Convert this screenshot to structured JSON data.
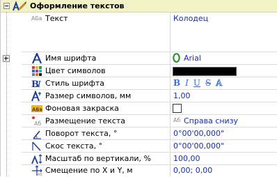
{
  "header": {
    "title": "Оформление текстов"
  },
  "rows": {
    "text": {
      "label": "Текст",
      "value": "Колодец",
      "icon": "abv-text-icon"
    },
    "font_name": {
      "label": "Имя шрифта",
      "value": "Arial",
      "icon": "font-a-icon"
    },
    "color": {
      "label": "Цвет символов",
      "value_color": "#000000",
      "icon": "color-grid-icon"
    },
    "font_style": {
      "label": "Стиль шрифта",
      "styles": [
        "B",
        "I",
        "U",
        "S",
        "A"
      ],
      "icon": "bold-italic-icon"
    },
    "size": {
      "label": "Размер символов, мм",
      "value": "1,00",
      "icon": "font-size-icon"
    },
    "background": {
      "label": "Фоновая закраска",
      "checked": false,
      "icon": "abv-background-icon"
    },
    "placement": {
      "label": "Размещение текста",
      "value": "Справа снизу",
      "value_icon_text": "Аб",
      "icon": "text-placement-icon"
    },
    "rotation": {
      "label": "Поворот текста, °",
      "value": "0°00'00,000\"",
      "icon": "rotate-text-icon"
    },
    "skew": {
      "label": "Скос текста, °",
      "value": "0°00'00,000\"",
      "icon": "skew-text-icon"
    },
    "vscale": {
      "label": "Масштаб по вертикали, %",
      "value": "100,00",
      "icon": "vertical-scale-icon"
    },
    "offset": {
      "label": "Смещение по X и Y, м",
      "value": "0,00; 0,00",
      "icon": "offset-xy-icon"
    }
  },
  "colors": {
    "header_bg": "#f3f1c6",
    "value_text": "#1a2d9a",
    "style_buttons": "#3b6bd6"
  }
}
